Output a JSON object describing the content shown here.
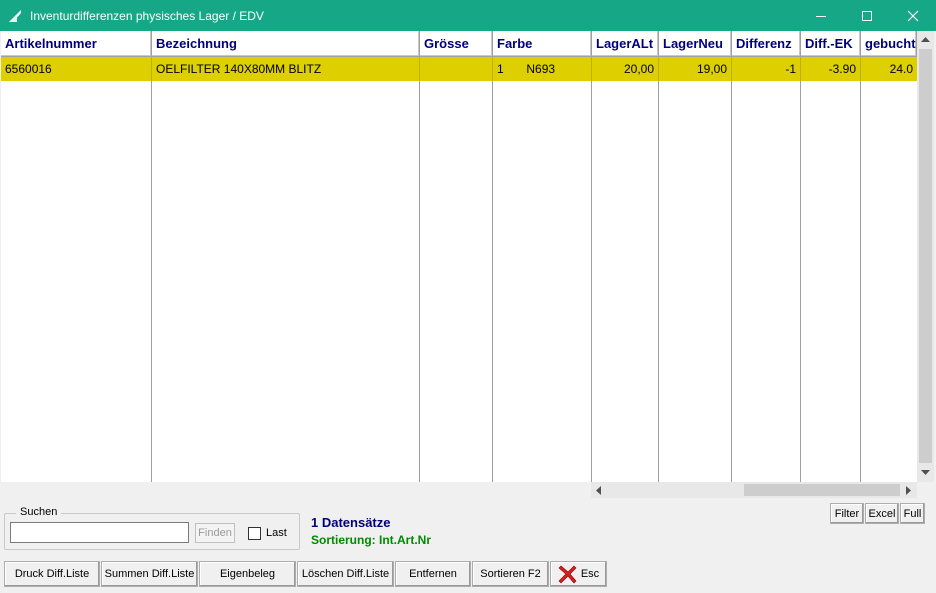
{
  "window": {
    "title": "Inventurdifferenzen physisches Lager / EDV",
    "controls": [
      "minimize",
      "maximize",
      "close"
    ]
  },
  "grid": {
    "columns": [
      "Artikelnummer",
      "Bezeichnung",
      "Grösse",
      "Farbe",
      "LagerALt",
      "LagerNeu",
      "Differenz",
      "Diff.-EK",
      "gebucht"
    ],
    "rows": [
      {
        "artikelnummer": "6560016",
        "bezeichnung": "OELFILTER 140X80MM BLITZ",
        "groesse": "",
        "farbe_code": "1",
        "farbe_name": "N693",
        "lager_alt": "20,00",
        "lager_neu": "19,00",
        "differenz": "-1",
        "diff_ek": "-3.90",
        "gebucht": "24.0"
      }
    ],
    "selected_row_color": "#ddcf00",
    "header_text_color": "#00007a"
  },
  "search": {
    "group_label": "Suchen",
    "value": "",
    "find_label": "Finden",
    "last_label": "Last",
    "last_checked": false
  },
  "status": {
    "count": "1 Datensätze",
    "sort": "Sortierung: Int.Art.Nr",
    "count_color": "#00007a",
    "sort_color": "#008a00"
  },
  "view_buttons": {
    "filter": "Filter",
    "excel": "Excel",
    "full": "Full"
  },
  "buttons": {
    "druck": "Druck Diff.Liste",
    "summen": "Summen Diff.Liste",
    "eigenbeleg": "Eigenbeleg",
    "loeschen": "Löschen Diff.Liste",
    "entfernen": "Entfernen",
    "sortieren": "Sortieren F2",
    "esc": "Esc"
  },
  "colors": {
    "titlebar": "#16a787",
    "window_bg": "#f0f0f0"
  }
}
